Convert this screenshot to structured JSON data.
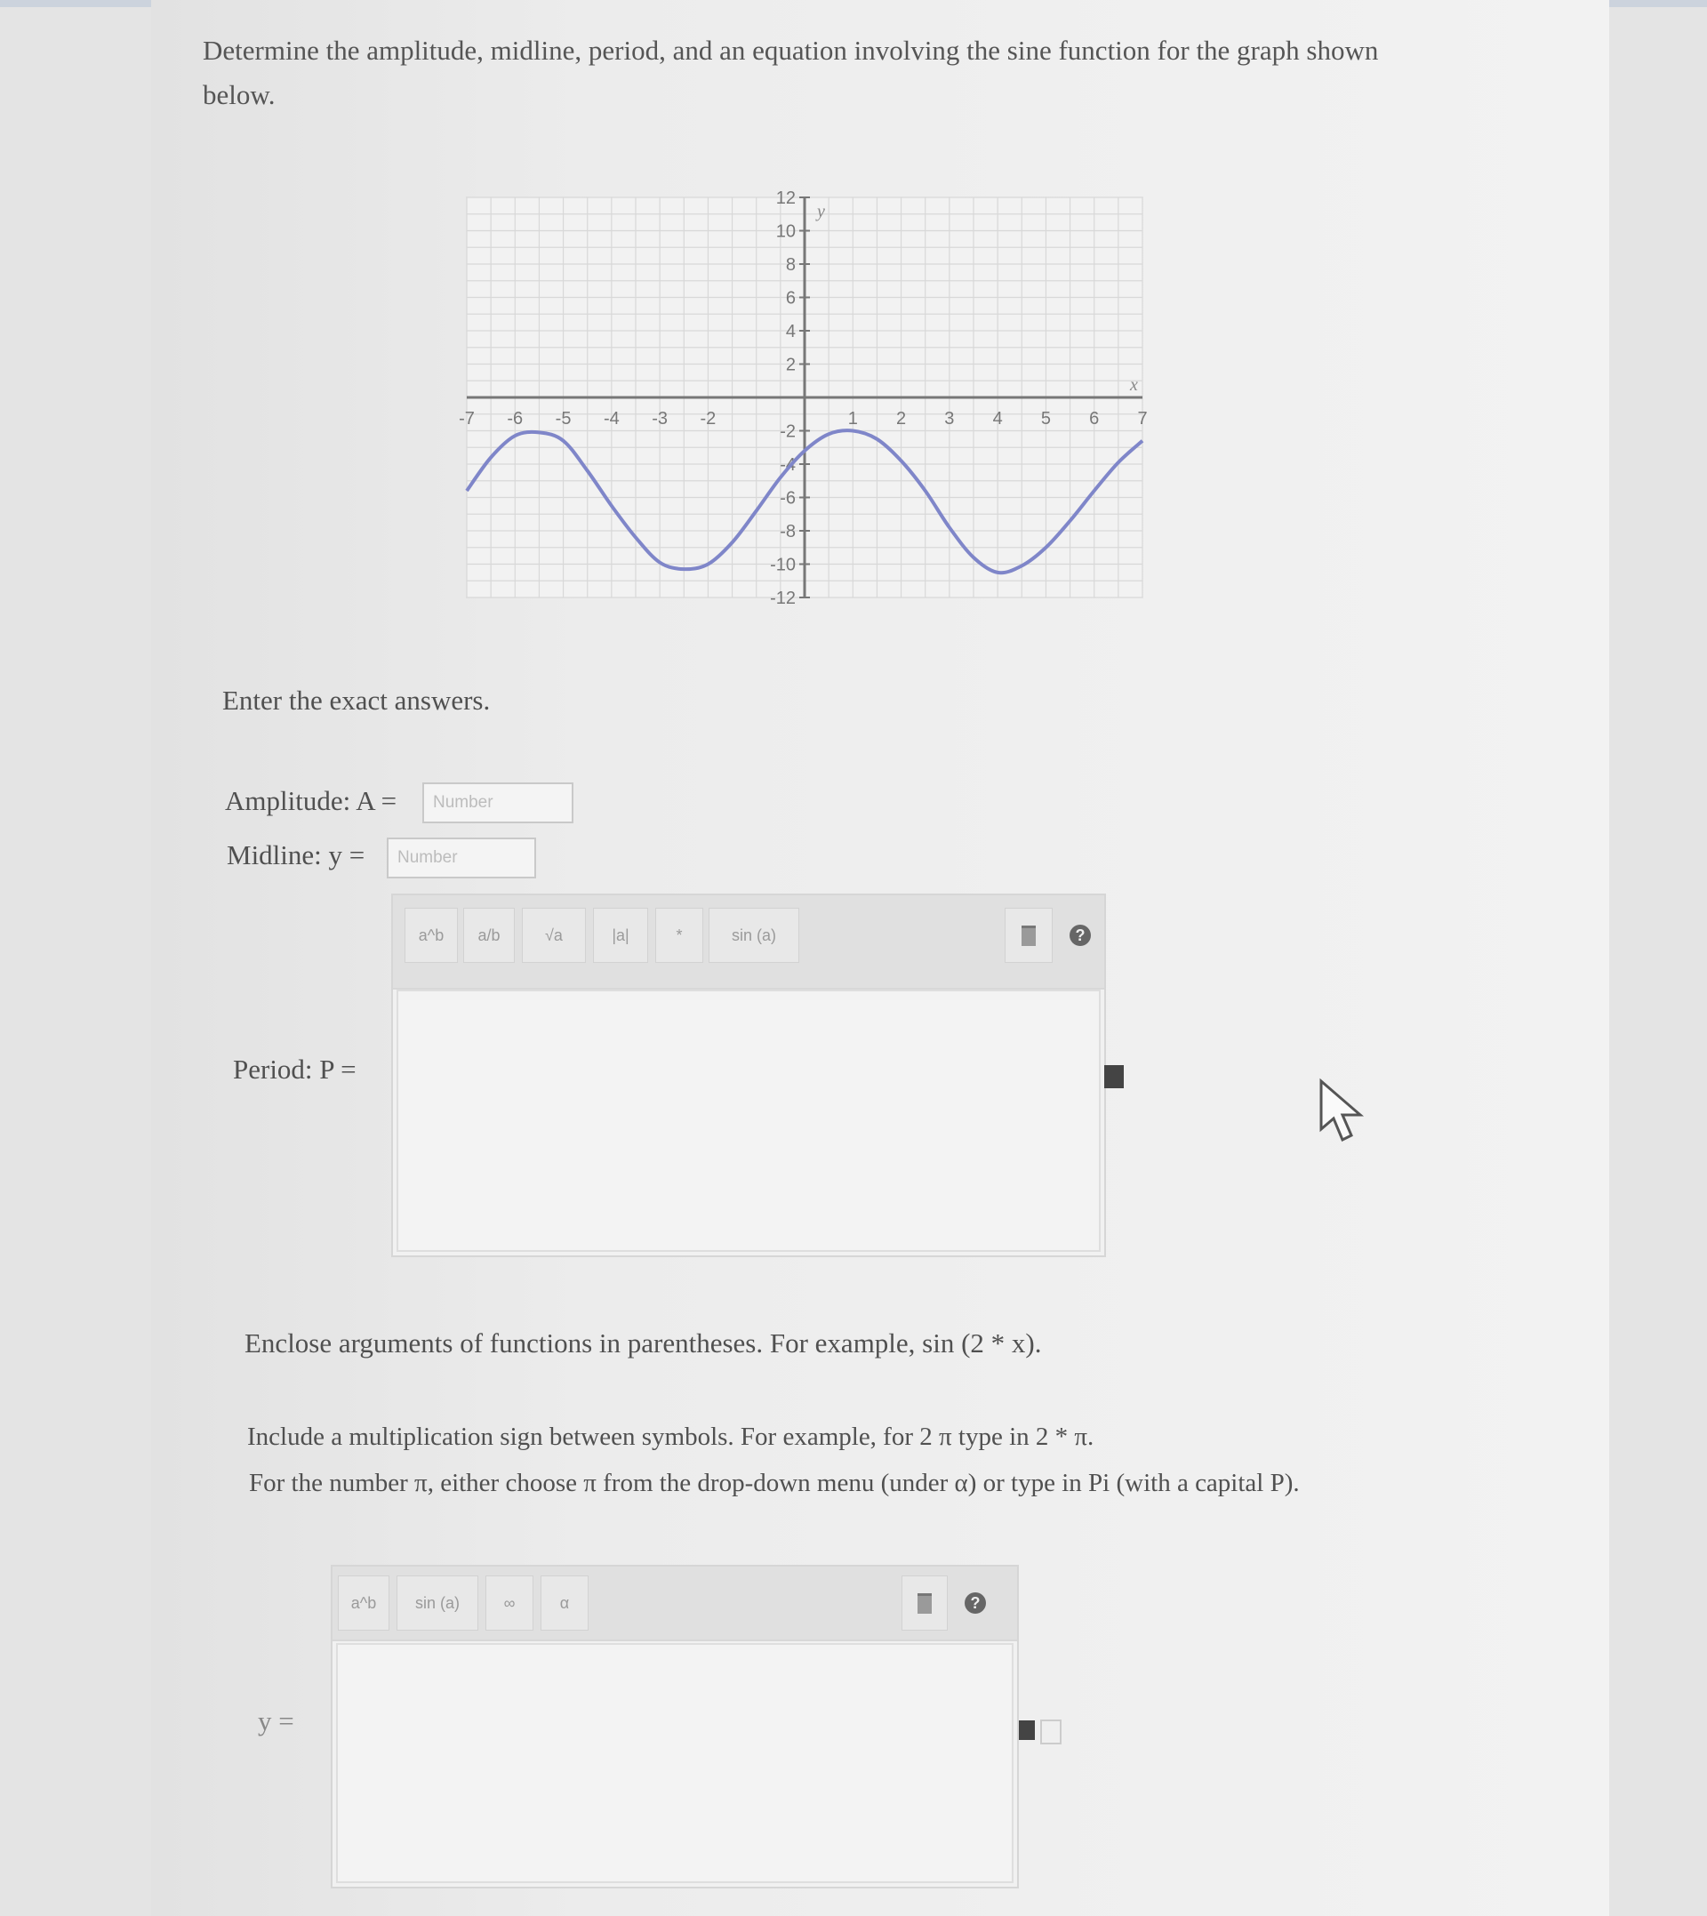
{
  "question": {
    "text": "Determine the amplitude, midline, period, and an equation involving the sine function for the graph shown below."
  },
  "chart_data": {
    "type": "line",
    "xlabel": "x",
    "ylabel": "y",
    "xlim": [
      -7,
      7
    ],
    "ylim": [
      -12,
      12
    ],
    "x_ticks": [
      -7,
      -6,
      -5,
      -4,
      -3,
      -2,
      1,
      2,
      3,
      4,
      5,
      6,
      7
    ],
    "y_ticks": [
      12,
      10,
      8,
      6,
      4,
      2,
      -2,
      -4,
      -6,
      -8,
      -10,
      -12
    ],
    "grid": true,
    "series": [
      {
        "color": "#7f86c9",
        "x": [
          -7,
          -6.5,
          -6,
          -5.5,
          -5,
          -4.5,
          -4,
          -3.5,
          -3,
          -2.5,
          -2,
          -1.5,
          -1,
          -0.5,
          0,
          0.5,
          1,
          1.5,
          2,
          2.5,
          3,
          3.5,
          4,
          4.5,
          5,
          5.5,
          6,
          6.5,
          7
        ],
        "y": [
          -5.6,
          -3.6,
          -2.3,
          -2.1,
          -2.6,
          -4.4,
          -6.5,
          -8.4,
          -9.9,
          -10.3,
          -10,
          -8.7,
          -6.8,
          -4.8,
          -3.2,
          -2.2,
          -2,
          -2.5,
          -3.8,
          -5.6,
          -7.8,
          -9.6,
          -10.5,
          -10.1,
          -9,
          -7.4,
          -5.6,
          -3.9,
          -2.6
        ]
      }
    ]
  },
  "instructions": {
    "enter_exact": "Enter the exact answers.",
    "enclose_args": "Enclose arguments of functions in parentheses. For example, sin (2 * x).",
    "mult_sign": "Include a multiplication sign between symbols. For example, for 2 π type in 2 * π.",
    "pi_note": "For the number π, either choose π from the drop-down menu (under α) or type in Pi (with a capital P)."
  },
  "amplitude": {
    "label": "Amplitude: A =",
    "placeholder": "Number"
  },
  "midline": {
    "label": "Midline: y =",
    "placeholder": "Number"
  },
  "period": {
    "label": "Period: P =",
    "toolbar": [
      "a^b",
      "a/b",
      "√a",
      "|a|",
      "*",
      "sin (a)"
    ]
  },
  "equation": {
    "label": "y =",
    "toolbar": [
      "a^b",
      "sin (a)",
      "∞",
      "α"
    ]
  },
  "colors": {
    "curve": "#7f86c9",
    "grid": "#d8d8d8",
    "axis": "#777777"
  }
}
